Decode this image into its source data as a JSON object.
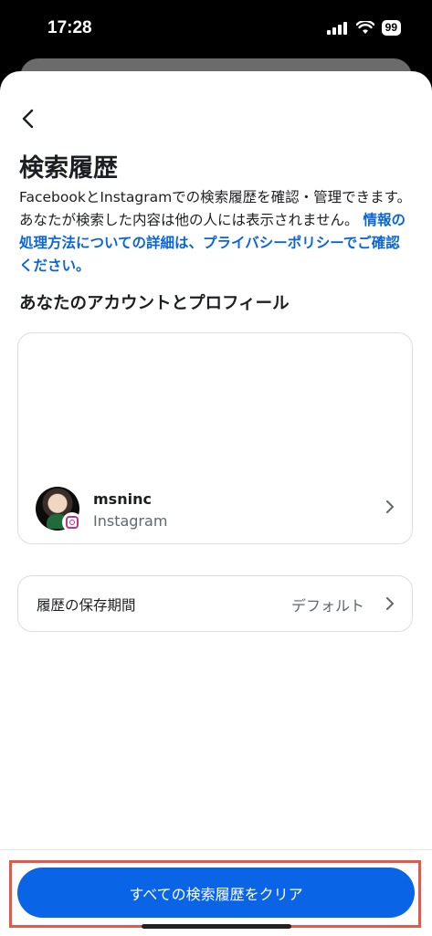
{
  "status_bar": {
    "time": "17:28",
    "battery": "99"
  },
  "header": {
    "title": "検索履歴"
  },
  "description": {
    "text": "FacebookとInstagramでの検索履歴を確認・管理できます。あなたが検索した内容は他の人には表示されません。",
    "link": "情報の処理方法についての詳細は、プライバシーポリシーでご確認ください。"
  },
  "accounts_section": {
    "title": "あなたのアカウントとプロフィール",
    "accounts": [
      {
        "name": "msninc",
        "platform": "Instagram"
      }
    ]
  },
  "retention": {
    "label": "履歴の保存期間",
    "value": "デフォルト"
  },
  "footer": {
    "clear_button": "すべての検索履歴をクリア"
  },
  "colors": {
    "accent": "#0a64e6",
    "link": "#0a66d8",
    "highlight": "#e05a4e"
  }
}
